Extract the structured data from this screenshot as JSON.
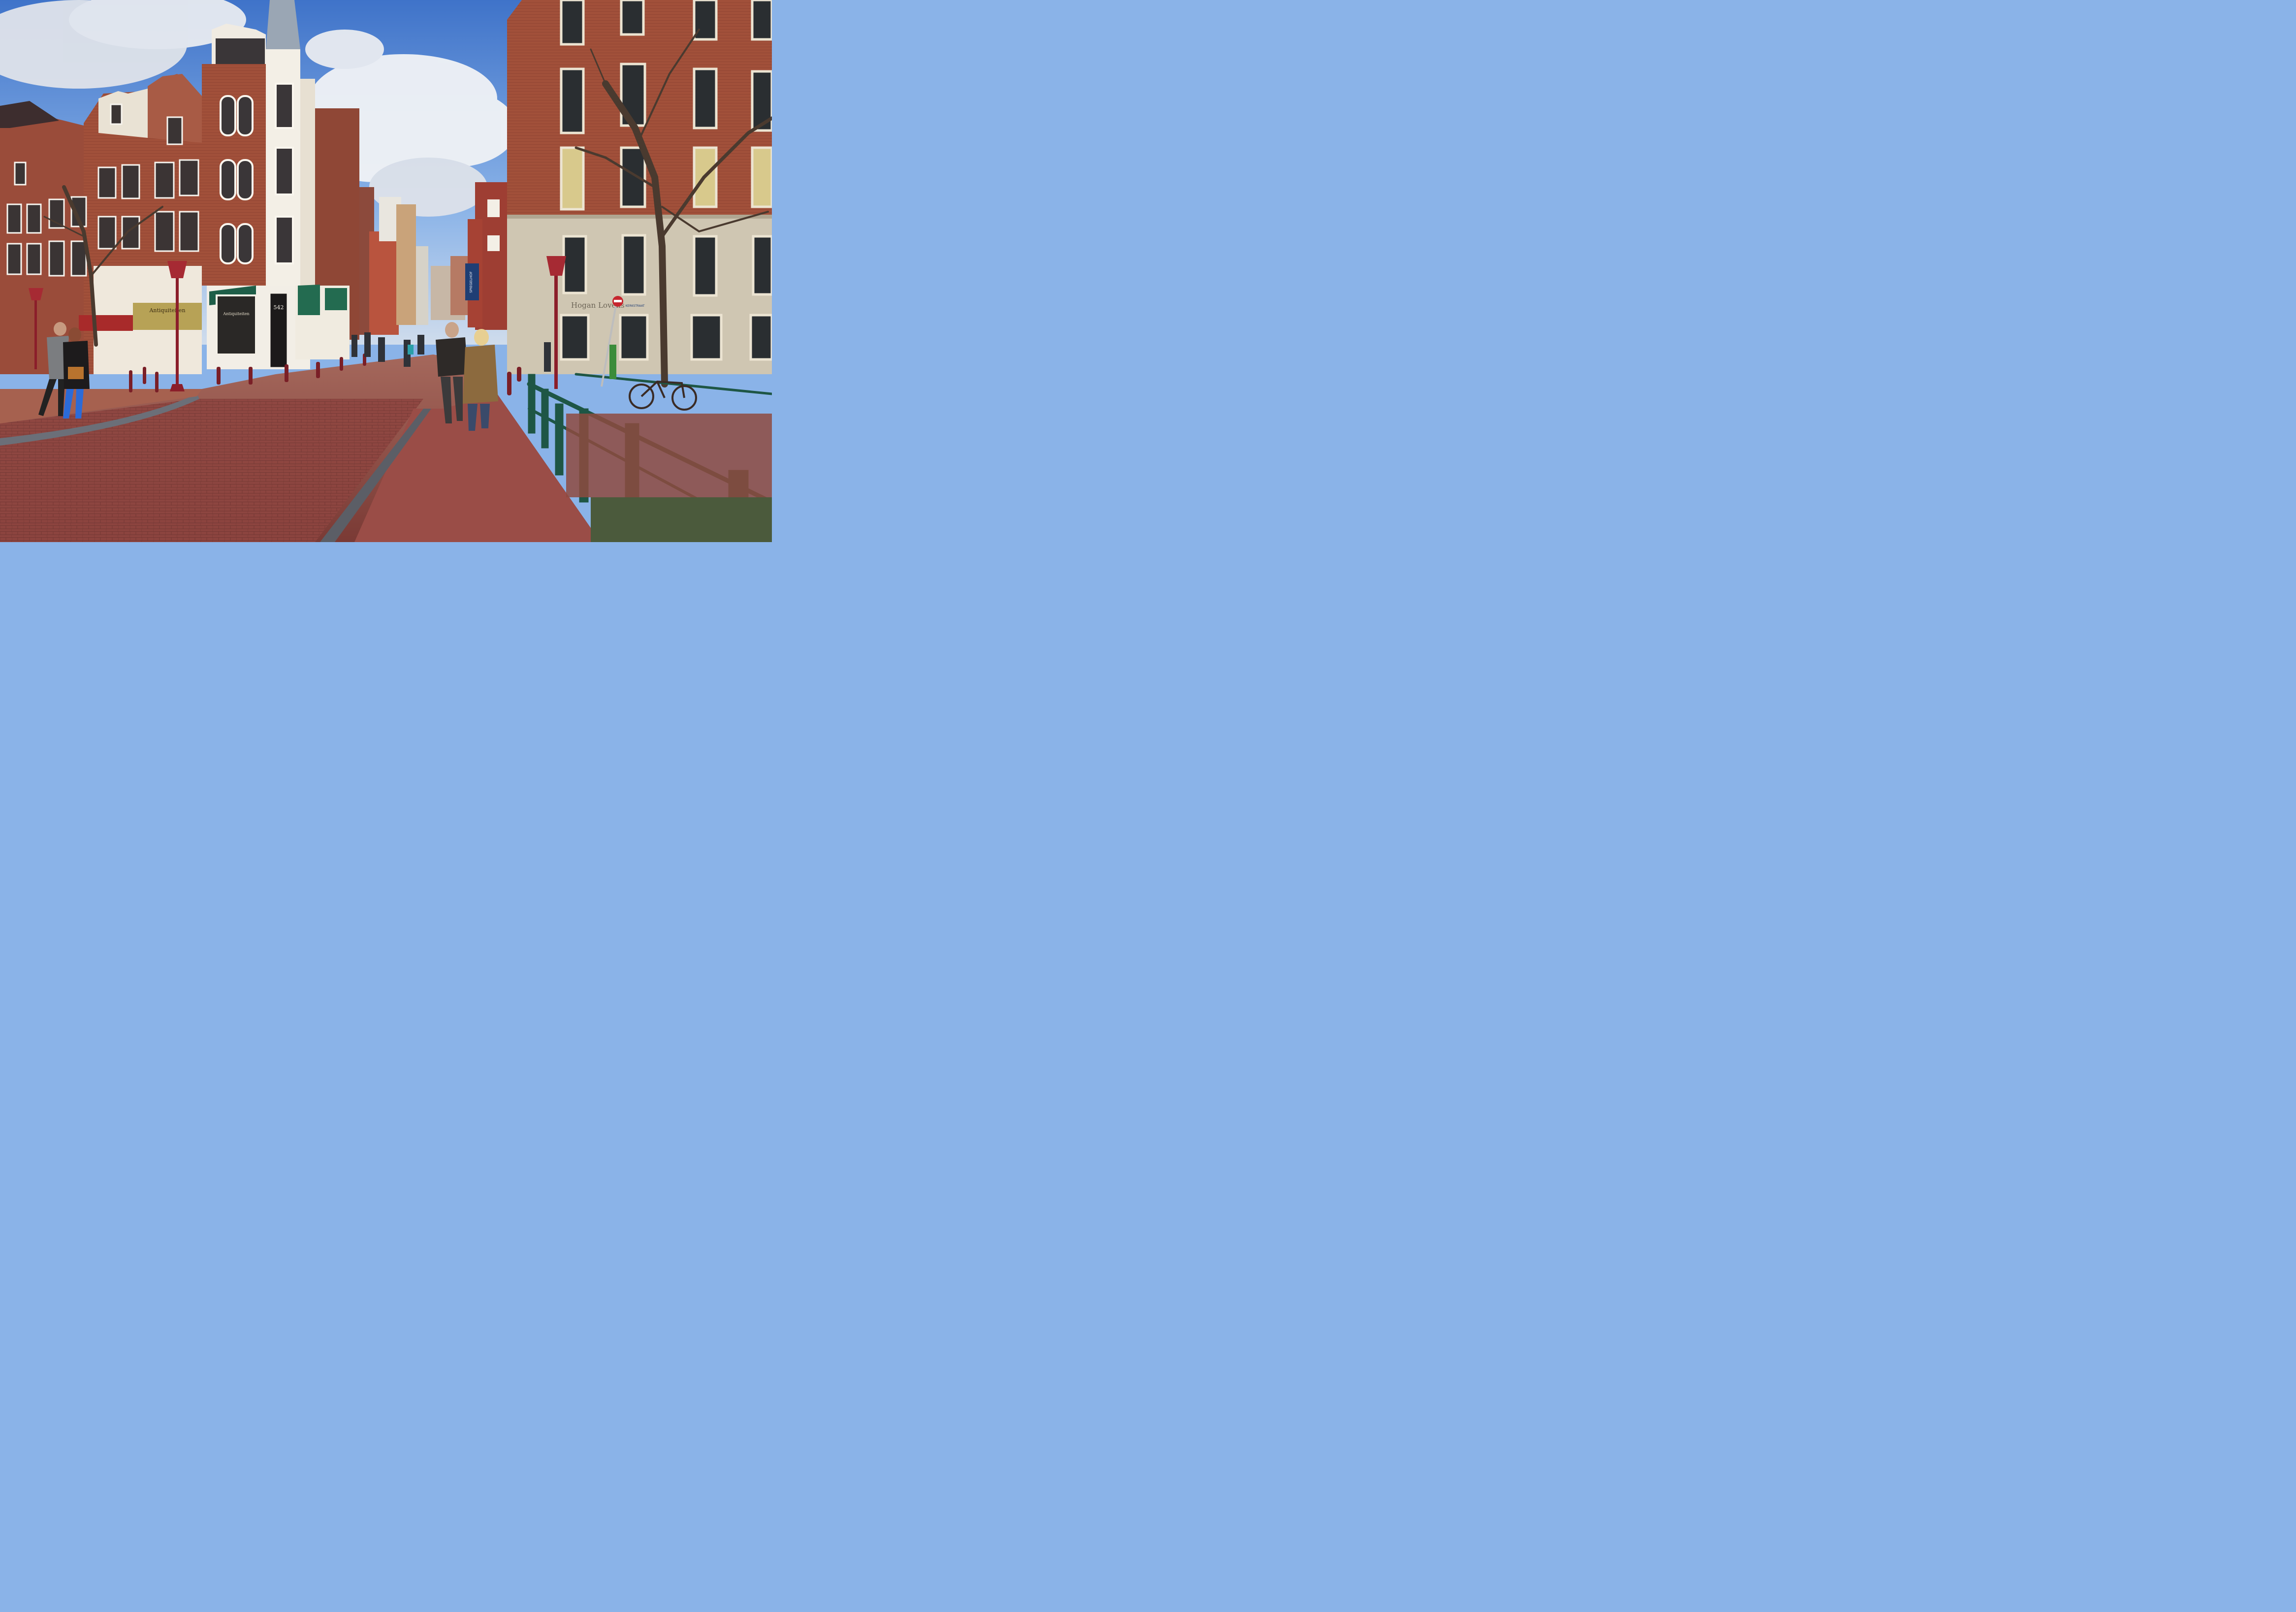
{
  "scene": {
    "house_number": "542",
    "lower_sign": "Antiquiteiten",
    "awning_text": "Antiquiteiten",
    "street_banner": "SPIEGELHOF",
    "corner_company_sign": "Hogan Lovells",
    "street_name_plate": "KERKSTRAAT"
  },
  "palette": {
    "sky": "#7aa7e3",
    "brick": "#9c4a36",
    "brick_light": "#b45d45",
    "stone": "#d8cbb4",
    "pavement": "#93504a",
    "railing": "#1f5a46",
    "lamp": "#8b1e2a"
  }
}
